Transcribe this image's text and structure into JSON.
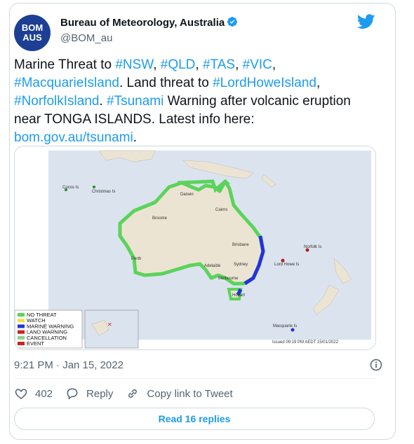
{
  "author": {
    "avatar_line1": "BOM",
    "avatar_line2": "AUS",
    "name": "Bureau of Meteorology, Australia",
    "handle": "@BOM_au"
  },
  "tweet": {
    "t1": "Marine Threat to ",
    "h_nsw": "#NSW",
    "c1": ", ",
    "h_qld": "#QLD",
    "c2": ", ",
    "h_tas": "#TAS",
    "c3": ", ",
    "h_vic": "#VIC",
    "c4": ",",
    "h_macq": "#MacquarieIsland",
    "t2": ". Land threat to ",
    "h_lordhowe": "#LordHoweIsland",
    "c5": ",",
    "h_norfolk": "#NorfolkIsland",
    "t3": ". ",
    "h_tsunami": "#Tsunami",
    "t4": " Warning after volcanic eruption near TONGA ISLANDS. Latest info here:",
    "link": "bom.gov.au/tsunami",
    "t5": "."
  },
  "map": {
    "labels": {
      "cocos": "Cocos Is",
      "christmas": "Christmas Is",
      "darwin": "Darwin",
      "cairns": "Cairns",
      "broome": "Broome",
      "brisbane": "Brisbane",
      "norfolk": "Norfolk Is",
      "lordhowe": "Lord Howe Is",
      "perth": "Perth",
      "adelaide": "Adelaide",
      "sydney": "Sydney",
      "melbourne": "Melbourne",
      "hobart": "Hobart",
      "macquarie": "Macquarie Is"
    },
    "legend": [
      {
        "label": "NO THREAT",
        "color": "#5bd35b"
      },
      {
        "label": "WATCH",
        "color": "#f3e04a"
      },
      {
        "label": "MARINE WARNING",
        "color": "#2233dd"
      },
      {
        "label": "LAND WARNING",
        "color": "#cc2222"
      },
      {
        "label": "CANCELLATION",
        "color": "#8fd18f"
      },
      {
        "label": "EVENT",
        "color": "#cc2222"
      }
    ],
    "issued": "Issued 09:19 PM AEDT 15/01/2022"
  },
  "meta": {
    "timestamp": "9:21 PM · Jan 15, 2022"
  },
  "actions": {
    "likes": "402",
    "reply": "Reply",
    "copy": "Copy link to Tweet"
  },
  "replies_button": "Read 16 replies",
  "colors": {
    "link": "#1d9bf0",
    "like_red": "#f91880",
    "ocean": "#dbe3ee",
    "land": "#ece4d2",
    "no_threat": "#5bd35b",
    "marine_warning": "#2233dd"
  }
}
